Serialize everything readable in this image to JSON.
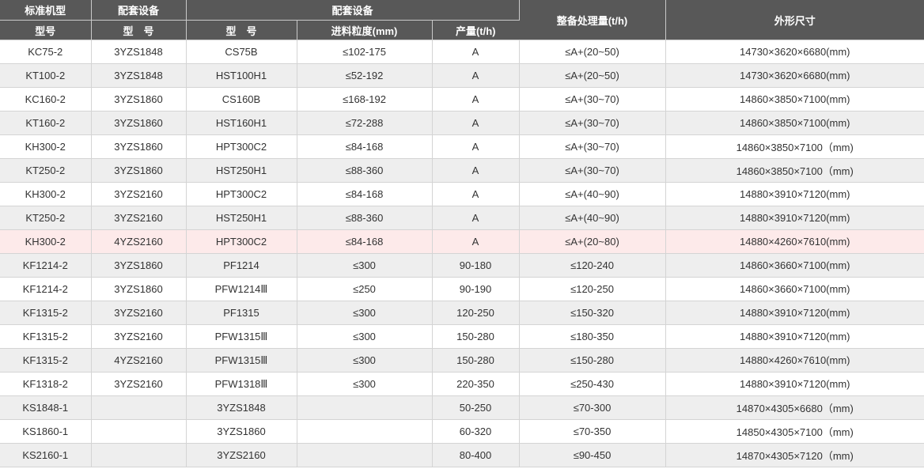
{
  "header": {
    "col1_top": "标准机型",
    "col1_bottom": "型号",
    "col2_top": "配套设备",
    "col2_bottom": "型　号",
    "group_top": "配套设备",
    "col3": "型　号",
    "col4": "进料粒度(mm)",
    "col5": "产量(t/h)",
    "col6": "整备处理量(t/h)",
    "col7": "外形尺寸"
  },
  "rows": [
    {
      "model": "KC75-2",
      "equip": "3YZS1848",
      "type": "CS75B",
      "feed": "≤102-175",
      "output": "A",
      "capacity": "≤A+(20~50)",
      "size": "14730×3620×6680(mm)"
    },
    {
      "model": "KT100-2",
      "equip": "3YZS1848",
      "type": "HST100H1",
      "feed": "≤52-192",
      "output": "A",
      "capacity": "≤A+(20~50)",
      "size": "14730×3620×6680(mm)"
    },
    {
      "model": "KC160-2",
      "equip": "3YZS1860",
      "type": "CS160B",
      "feed": "≤168-192",
      "output": "A",
      "capacity": "≤A+(30~70)",
      "size": "14860×3850×7100(mm)"
    },
    {
      "model": "KT160-2",
      "equip": "3YZS1860",
      "type": "HST160H1",
      "feed": "≤72-288",
      "output": "A",
      "capacity": "≤A+(30~70)",
      "size": "14860×3850×7100(mm)"
    },
    {
      "model": "KH300-2",
      "equip": "3YZS1860",
      "type": "HPT300C2",
      "feed": "≤84-168",
      "output": "A",
      "capacity": "≤A+(30~70)",
      "size": "14860×3850×7100（mm)"
    },
    {
      "model": "KT250-2",
      "equip": "3YZS1860",
      "type": "HST250H1",
      "feed": "≤88-360",
      "output": "A",
      "capacity": "≤A+(30~70)",
      "size": "14860×3850×7100（mm)"
    },
    {
      "model": "KH300-2",
      "equip": "3YZS2160",
      "type": "HPT300C2",
      "feed": "≤84-168",
      "output": "A",
      "capacity": "≤A+(40~90)",
      "size": "14880×3910×7120(mm)"
    },
    {
      "model": "KT250-2",
      "equip": "3YZS2160",
      "type": "HST250H1",
      "feed": "≤88-360",
      "output": "A",
      "capacity": "≤A+(40~90)",
      "size": "14880×3910×7120(mm)"
    },
    {
      "model": "KH300-2",
      "equip": "4YZS2160",
      "type": "HPT300C2",
      "feed": "≤84-168",
      "output": "A",
      "capacity": "≤A+(20~80)",
      "size": "14880×4260×7610(mm)"
    },
    {
      "model": "KF1214-2",
      "equip": "3YZS1860",
      "type": "PF1214",
      "feed": "≤300",
      "output": "90-180",
      "capacity": "≤120-240",
      "size": "14860×3660×7100(mm)"
    },
    {
      "model": "KF1214-2",
      "equip": "3YZS1860",
      "type": "PFW1214Ⅲ",
      "feed": "≤250",
      "output": "90-190",
      "capacity": "≤120-250",
      "size": "14860×3660×7100(mm)"
    },
    {
      "model": "KF1315-2",
      "equip": "3YZS2160",
      "type": "PF1315",
      "feed": "≤300",
      "output": "120-250",
      "capacity": "≤150-320",
      "size": "14880×3910×7120(mm)"
    },
    {
      "model": "KF1315-2",
      "equip": "3YZS2160",
      "type": "PFW1315Ⅲ",
      "feed": "≤300",
      "output": "150-280",
      "capacity": "≤180-350",
      "size": "14880×3910×7120(mm)"
    },
    {
      "model": "KF1315-2",
      "equip": "4YZS2160",
      "type": "PFW1315Ⅲ",
      "feed": "≤300",
      "output": "150-280",
      "capacity": "≤150-280",
      "size": "14880×4260×7610(mm)"
    },
    {
      "model": "KF1318-2",
      "equip": "3YZS2160",
      "type": "PFW1318Ⅲ",
      "feed": "≤300",
      "output": "220-350",
      "capacity": "≤250-430",
      "size": "14880×3910×7120(mm)"
    },
    {
      "model": "KS1848-1",
      "equip": "",
      "type": "3YZS1848",
      "feed": "",
      "output": "50-250",
      "capacity": "≤70-300",
      "size": "14870×4305×6680（mm)"
    },
    {
      "model": "KS1860-1",
      "equip": "",
      "type": "3YZS1860",
      "feed": "",
      "output": "60-320",
      "capacity": "≤70-350",
      "size": "14850×4305×7100（mm)"
    },
    {
      "model": "KS2160-1",
      "equip": "",
      "type": "3YZS2160",
      "feed": "",
      "output": "80-400",
      "capacity": "≤90-450",
      "size": "14870×4305×7120（mm)"
    }
  ],
  "colors": {
    "header_bg": "#585858",
    "header_text": "#ffffff",
    "row_alt_bg": "#eeeeee",
    "row_highlight_bg": "#fdeaea"
  }
}
